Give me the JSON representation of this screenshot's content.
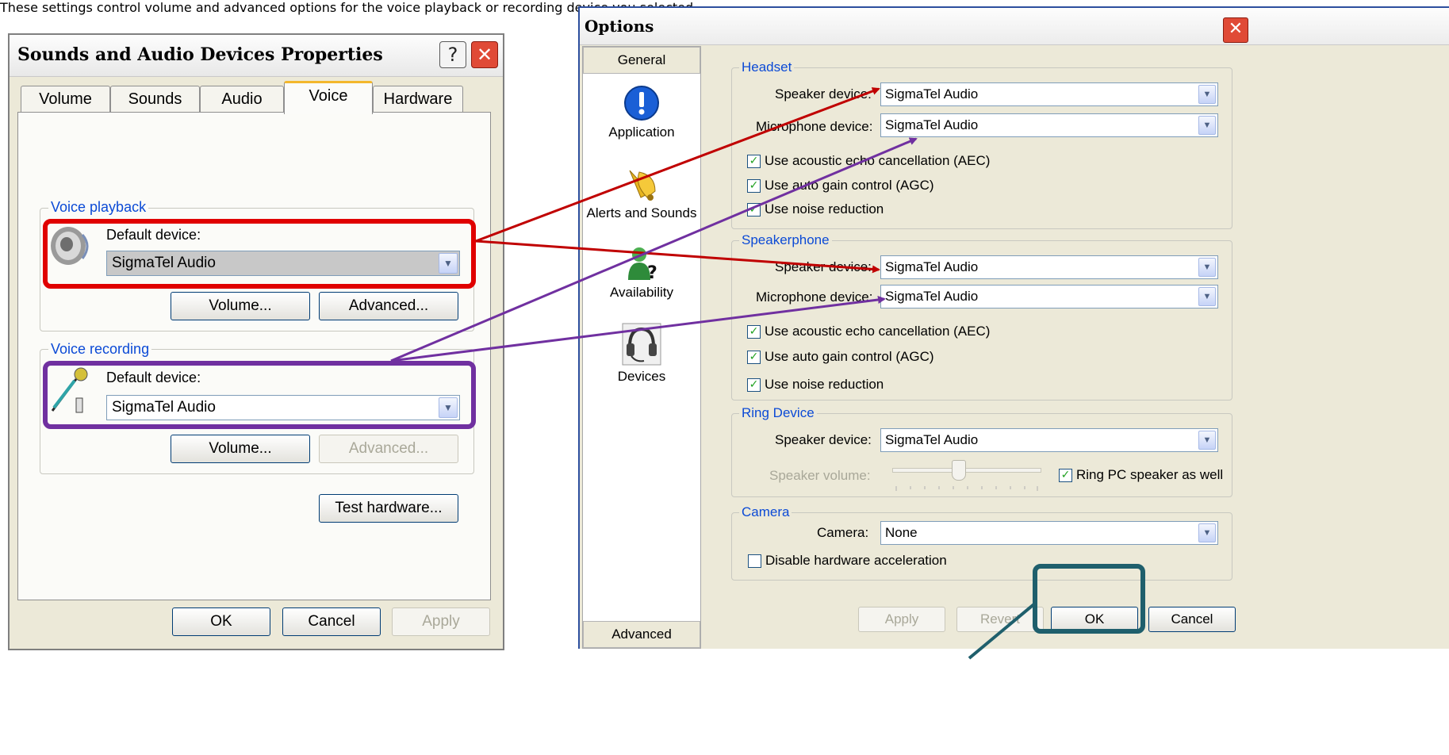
{
  "left_dialog": {
    "title": "Sounds and Audio Devices Properties",
    "help_glyph": "?",
    "close_glyph": "✕",
    "tabs": [
      "Volume",
      "Sounds",
      "Audio",
      "Voice",
      "Hardware"
    ],
    "active_tab": "Voice",
    "description": "These settings control volume and advanced options for the voice playback or recording device you selected.",
    "voice_playback": {
      "group_label": "Voice playback",
      "device_label": "Default device:",
      "device_value": "SigmaTel Audio",
      "volume_button": "Volume...",
      "advanced_button": "Advanced..."
    },
    "voice_recording": {
      "group_label": "Voice recording",
      "device_label": "Default device:",
      "device_value": "SigmaTel Audio",
      "volume_button": "Volume...",
      "advanced_button": "Advanced..."
    },
    "test_hardware_button": "Test hardware...",
    "ok_button": "OK",
    "cancel_button": "Cancel",
    "apply_button": "Apply"
  },
  "options_dialog": {
    "title": "Options",
    "close_glyph": "✕",
    "nav": {
      "header": "General",
      "items": [
        "Application",
        "Alerts and Sounds",
        "Availability",
        "Devices"
      ],
      "footer": "Advanced"
    },
    "headset": {
      "group_label": "Headset",
      "speaker_label": "Speaker device:",
      "speaker_value": "SigmaTel Audio",
      "microphone_label": "Microphone device:",
      "microphone_value": "SigmaTel Audio",
      "aec": "Use acoustic echo cancellation (AEC)",
      "agc": "Use auto gain control (AGC)",
      "noise": "Use noise reduction"
    },
    "speakerphone": {
      "group_label": "Speakerphone",
      "speaker_label": "Speaker device:",
      "speaker_value": "SigmaTel Audio",
      "microphone_label": "Microphone device:",
      "microphone_value": "SigmaTel Audio",
      "aec": "Use acoustic echo cancellation (AEC)",
      "agc": "Use auto gain control (AGC)",
      "noise": "Use noise reduction"
    },
    "ring_device": {
      "group_label": "Ring Device",
      "speaker_label": "Speaker device:",
      "speaker_value": "SigmaTel Audio",
      "volume_label": "Speaker volume:",
      "volume_level": 0.45,
      "ring_pc_label": "Ring PC speaker as well"
    },
    "camera": {
      "group_label": "Camera",
      "camera_label": "Camera:",
      "camera_value": "None",
      "disable_hw_label": "Disable hardware acceleration"
    },
    "buttons": {
      "apply": "Apply",
      "revert": "Revert",
      "ok": "OK",
      "cancel": "Cancel"
    }
  },
  "colors": {
    "playback_highlight": "#e00000",
    "recording_highlight": "#7030a0",
    "ok_highlight": "#1f5f6c"
  }
}
